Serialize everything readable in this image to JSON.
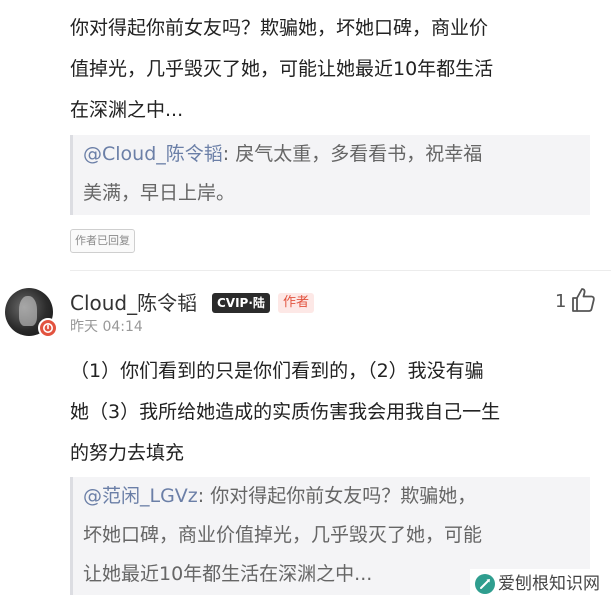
{
  "top_comment": {
    "text_lines": [
      "你对得起你前女友吗？欺骗她，坏她口碑，商业价",
      "值掉光，几乎毁灭了她，可能让她最近10年都生活",
      "在深渊之中..."
    ],
    "quote": {
      "mention": "@Cloud_陈令韬",
      "lines": [
        ": 戾气太重，多看看书，祝幸福",
        "美满，早日上岸。"
      ]
    },
    "replied_badge": "作者已回复"
  },
  "reply": {
    "username": "Cloud_陈令韬",
    "vip_badge": "CVIP·陆",
    "author_badge": "作者",
    "timestamp": "昨天 04:14",
    "like_count": "1",
    "text_lines": [
      "（1）你们看到的只是你们看到的，（2）我没有骗",
      "她（3）我所给她造成的实质伤害我会用我自己一生",
      "的努力去填充"
    ],
    "quote": {
      "mention": "@范闲_LGVz",
      "lines": [
        ": 你对得起你前女友吗？欺骗她，",
        "坏她口碑，商业价值掉光，几乎毁灭了她，可能",
        "让她最近10年都生活在深渊之中..."
      ]
    }
  },
  "watermark": {
    "text": "爱刨根知识网",
    "icon": "shovel-logo-icon"
  },
  "colors": {
    "accent_red": "#e2533f",
    "mention_blue": "#6b7fa7",
    "quote_bg": "#f4f4f6"
  }
}
